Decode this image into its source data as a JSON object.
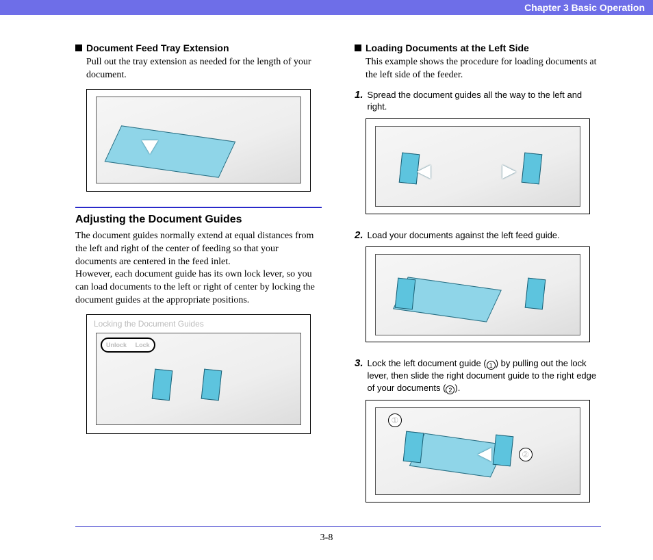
{
  "header": {
    "chapter": "Chapter 3   Basic Operation"
  },
  "left": {
    "sec1": {
      "title": "Document Feed Tray Extension",
      "text": "Pull out the tray extension as needed for the length of your document."
    },
    "sec2": {
      "title": "Adjusting the Document Guides",
      "para1": "The document guides normally extend at equal distances from the left and right of the center of feeding so that your documents are centered in the feed inlet.",
      "para2": "However, each document guide has its own lock lever, so you can load documents to the left or right of center by locking the document guides at the appropriate positions.",
      "fig_caption": "Locking the Document Guides",
      "unlock_label": "Unlock",
      "lock_label": "Lock"
    }
  },
  "right": {
    "sec1": {
      "title": "Loading Documents at the Left Side",
      "text": "This example shows the procedure for loading documents at the left side of the feeder."
    },
    "steps": {
      "s1": {
        "num": "1.",
        "text": "Spread the document guides all the way to the left and right."
      },
      "s2": {
        "num": "2.",
        "text": "Load your documents against the left feed guide."
      },
      "s3": {
        "num": "3.",
        "text_a": "Lock the left document guide (",
        "c1": "1",
        "text_b": ") by pulling out the lock lever, then slide the right document guide to the right edge of your documents (",
        "c2": "2",
        "text_c": ")."
      }
    }
  },
  "footer": {
    "page": "3-8"
  }
}
